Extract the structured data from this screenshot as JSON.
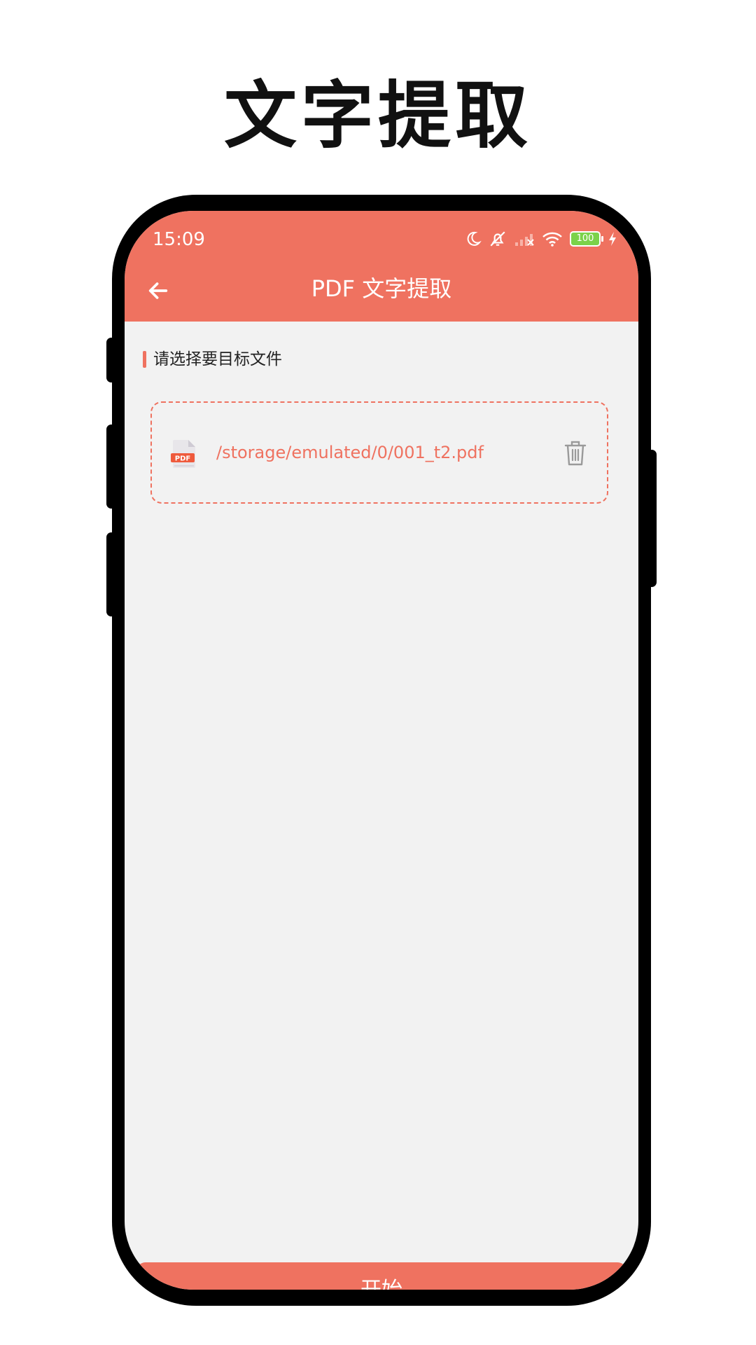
{
  "promo": {
    "title": "文字提取"
  },
  "status_bar": {
    "time": "15:09",
    "battery_level": "100",
    "icons": [
      "moon-icon",
      "bell-off-icon",
      "signal-icon",
      "wifi-icon",
      "battery-icon",
      "charging-icon"
    ]
  },
  "app_bar": {
    "title": "PDF 文字提取",
    "back_icon": "arrow-left-icon"
  },
  "section": {
    "label": "请选择要目标文件"
  },
  "file": {
    "path": "/storage/emulated/0/001_t2.pdf",
    "icon": "pdf-file-icon",
    "icon_label": "PDF",
    "delete_icon": "trash-icon"
  },
  "actions": {
    "start_label": "开始"
  },
  "colors": {
    "accent": "#ef7260",
    "background": "#f2f2f2",
    "battery": "#7bd24a"
  }
}
